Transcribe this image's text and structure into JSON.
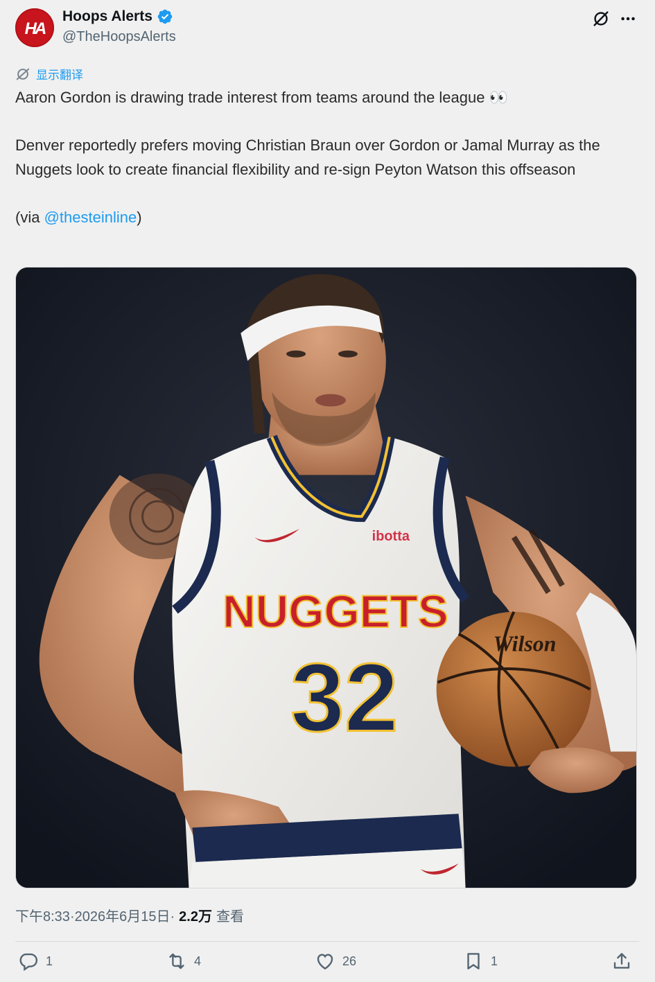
{
  "author": {
    "display_name": "Hoops Alerts",
    "handle": "@TheHoopsAlerts",
    "avatar_text": "HA",
    "verified": true
  },
  "translate_label": "显示翻译",
  "text": {
    "line1": "Aaron Gordon is drawing trade interest from teams around the league 👀",
    "line2": "Denver reportedly prefers moving Christian Braun over Gordon or Jamal Murray as the Nuggets look to create financial flexibility and re-sign Peyton Watson this offseason",
    "via_prefix": "(via ",
    "via_mention": "@thesteinline",
    "via_suffix": ")"
  },
  "media": {
    "jersey_team": "NUGGETS",
    "jersey_number": "32",
    "jersey_sponsor": "ibotta",
    "ball_brand": "Wilson"
  },
  "meta": {
    "time": "下午8:33",
    "sep1": " · ",
    "date": "2026年6月15日",
    "sep2": " · ",
    "views_count": "2.2万",
    "views_label": "查看"
  },
  "actions": {
    "reply_count": "1",
    "retweet_count": "4",
    "like_count": "26",
    "bookmark_count": "1"
  },
  "colors": {
    "accent": "#1d9bf0",
    "avatar_bg": "#c8141c",
    "muted": "#536471"
  }
}
